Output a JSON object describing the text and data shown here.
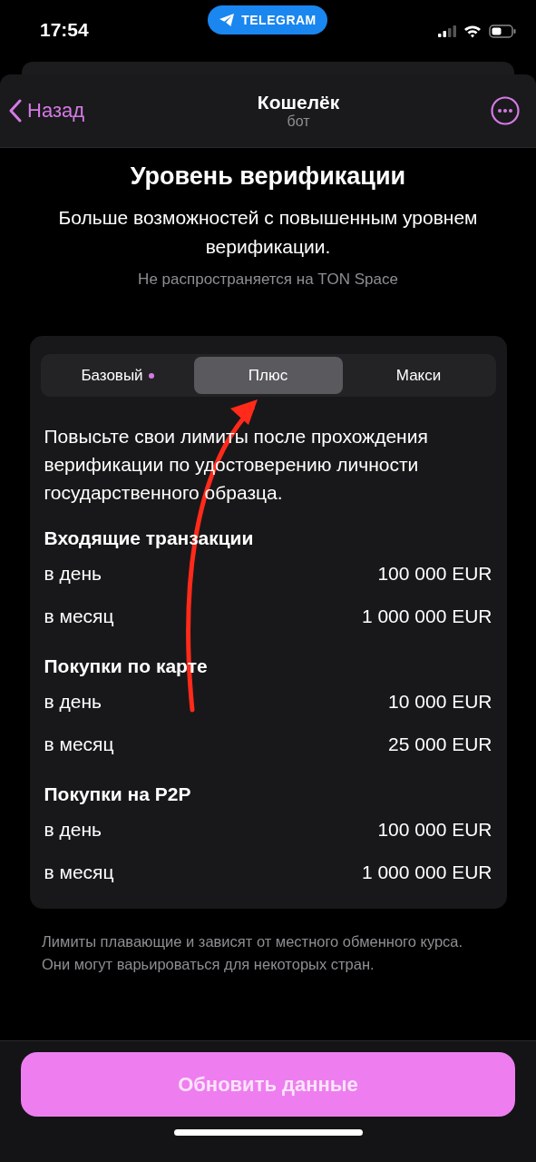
{
  "status_bar": {
    "time": "17:54",
    "app_pill": "TELEGRAM"
  },
  "header": {
    "back": "Назад",
    "title": "Кошелёк",
    "subtitle": "бот"
  },
  "title": "Уровень верификации",
  "subtitle": "Больше возможностей с повышенным уровнем верификации.",
  "note": "Не распространяется на TON Space",
  "tabs": [
    {
      "label": "Базовый",
      "selected": false,
      "current": true
    },
    {
      "label": "Плюс",
      "selected": true,
      "current": false
    },
    {
      "label": "Макси",
      "selected": false,
      "current": false
    }
  ],
  "description": "Повысьте свои лимиты после прохождения верификации по удостоверению личности государственного образца.",
  "sections": [
    {
      "title": "Входящие транзакции",
      "rows": [
        {
          "label": "в день",
          "value": "100 000 EUR"
        },
        {
          "label": "в месяц",
          "value": "1 000 000 EUR"
        }
      ]
    },
    {
      "title": "Покупки по карте",
      "rows": [
        {
          "label": "в день",
          "value": "10 000 EUR"
        },
        {
          "label": "в месяц",
          "value": "25 000 EUR"
        }
      ]
    },
    {
      "title": "Покупки на P2P",
      "rows": [
        {
          "label": "в день",
          "value": "100 000 EUR"
        },
        {
          "label": "в месяц",
          "value": "1 000 000 EUR"
        }
      ]
    }
  ],
  "footnote": "Лимиты плавающие и зависят от местного обменного курса. Они могут варьироваться для некоторых стран.",
  "button": "Обновить данные"
}
